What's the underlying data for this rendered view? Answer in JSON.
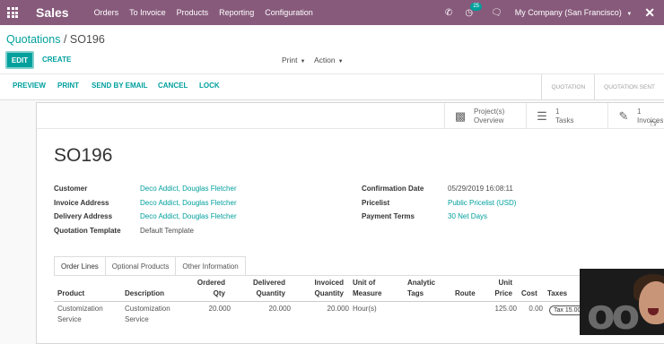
{
  "navbar": {
    "app_name": "Sales",
    "menu": [
      "Orders",
      "To Invoice",
      "Products",
      "Reporting",
      "Configuration"
    ],
    "activity_count": "25",
    "company": "My Company (San Francisco)"
  },
  "breadcrumb": {
    "parent": "Quotations",
    "separator": "/",
    "current": "SO196"
  },
  "toolbar": {
    "edit": "EDIT",
    "create": "CREATE",
    "print": "Print",
    "action": "Action"
  },
  "statusbar": {
    "buttons": [
      "PREVIEW",
      "PRINT",
      "SEND BY EMAIL",
      "CANCEL",
      "LOCK"
    ],
    "stages": [
      "QUOTATION",
      "QUOTATION SENT"
    ]
  },
  "smart_buttons": {
    "project": {
      "line1": "Project(s)",
      "line2": "Overview"
    },
    "tasks": {
      "count": "1",
      "label": "Tasks"
    },
    "invoices": {
      "count": "1",
      "label": "Invoices"
    }
  },
  "order": {
    "name": "SO196",
    "left_fields": [
      {
        "label": "Customer",
        "value": "Deco Addict, Douglas Fletcher"
      },
      {
        "label": "Invoice Address",
        "value": "Deco Addict, Douglas Fletcher"
      },
      {
        "label": "Delivery Address",
        "value": "Deco Addict, Douglas Fletcher"
      },
      {
        "label": "Quotation Template",
        "value": "Default Template"
      }
    ],
    "right_fields": [
      {
        "label": "Confirmation Date",
        "value": "05/29/2019 16:08:11"
      },
      {
        "label": "Pricelist",
        "value": "Public Pricelist (USD)"
      },
      {
        "label": "Payment Terms",
        "value": "30 Net Days"
      }
    ]
  },
  "tabs": [
    "Order Lines",
    "Optional Products",
    "Other Information"
  ],
  "order_lines": {
    "headers": {
      "product": "Product",
      "description": "Description",
      "ordered_qty": [
        "Ordered",
        "Qty"
      ],
      "delivered_qty": [
        "Delivered",
        "Quantity"
      ],
      "invoiced_qty": [
        "Invoiced",
        "Quantity"
      ],
      "uom": [
        "Unit of",
        "Measure"
      ],
      "analytic": [
        "Analytic",
        "Tags"
      ],
      "route": "Route",
      "unit_price": [
        "Unit",
        "Price"
      ],
      "cost": "Cost",
      "taxes": "Taxes"
    },
    "rows": [
      {
        "product": [
          "Customization",
          "Service"
        ],
        "description": [
          "Customization",
          "Service"
        ],
        "ordered_qty": "20.000",
        "delivered_qty": "20.000",
        "invoiced_qty": "20.000",
        "uom": "Hour(s)",
        "unit_price": "125.00",
        "cost": "0.00",
        "tax": "Tax 15.00"
      }
    ]
  },
  "webcam": {
    "logo_fragment": "oo"
  },
  "colors": {
    "navbar": "#875a7b",
    "accent": "#00a09d"
  }
}
